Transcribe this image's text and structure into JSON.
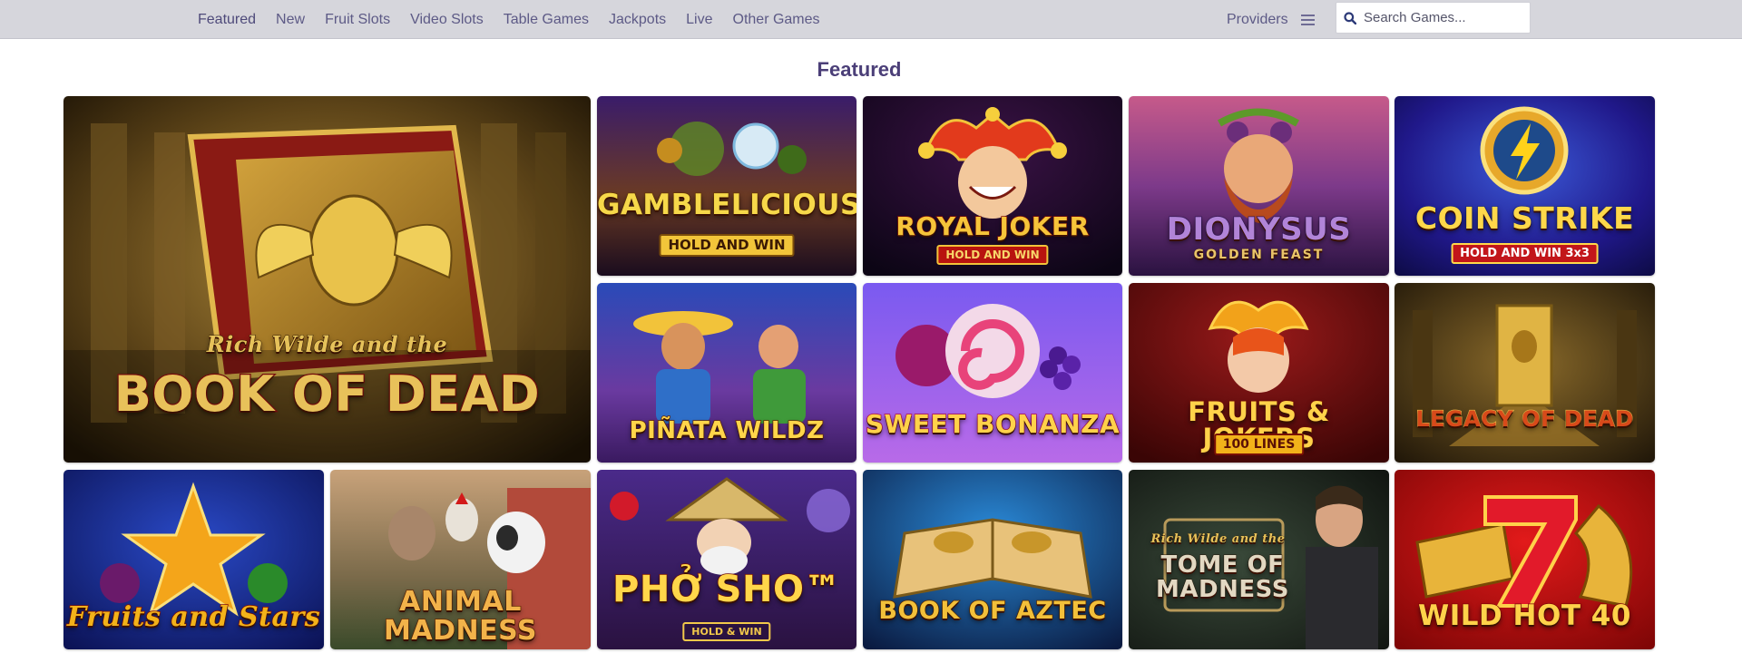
{
  "nav": {
    "items": [
      "Featured",
      "New",
      "Fruit Slots",
      "Video Slots",
      "Table Games",
      "Jackpots",
      "Live",
      "Other Games"
    ]
  },
  "providers": {
    "label": "Providers"
  },
  "search": {
    "placeholder": "Search Games..."
  },
  "section": {
    "title": "Featured"
  },
  "games": [
    {
      "title": "BOOK OF DEAD",
      "pretitle": "Rich Wilde and the"
    },
    {
      "title": "GAMBLELICIOUS",
      "subtitle": "HOLD AND WIN"
    },
    {
      "title": "ROYAL JOKER",
      "subtitle": "HOLD AND WIN"
    },
    {
      "title": "DIONYSUS",
      "subtitle": "GOLDEN FEAST"
    },
    {
      "title": "COIN STRIKE",
      "subtitle": "HOLD AND WIN 3x3"
    },
    {
      "title": "PIÑATA WILDZ"
    },
    {
      "title": "SWEET BONANZA"
    },
    {
      "title": "FRUITS & JOKERS",
      "subtitle": "100 LINES"
    },
    {
      "title": "LEGACY OF DEAD"
    },
    {
      "title": "Fruits and Stars"
    },
    {
      "title": "ANIMAL MADNESS"
    },
    {
      "title": "PHỞ SHO™",
      "subtitle": "HOLD & WIN"
    },
    {
      "title": "BOOK OF AZTEC"
    },
    {
      "title": "TOME OF MADNESS",
      "pretitle": "Rich Wilde and the"
    },
    {
      "title": "WILD HOT 40"
    }
  ],
  "colors": {
    "nav_bg": "#d6d6dc",
    "nav_text": "#5d5a86",
    "heading": "#4b3f78"
  }
}
